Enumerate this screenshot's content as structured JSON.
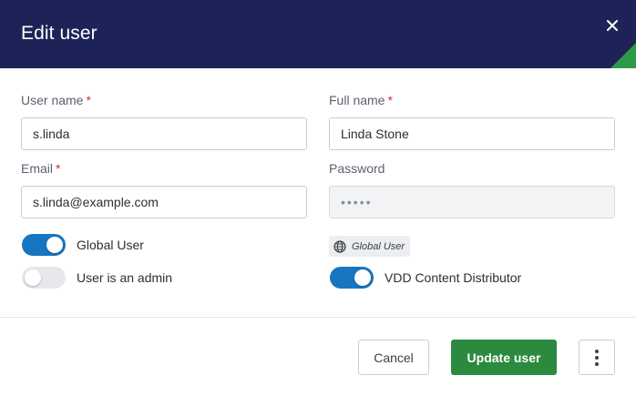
{
  "dialog": {
    "title": "Edit user",
    "close_icon": "close-icon"
  },
  "colors": {
    "header_bg": "#1d2357",
    "accent_green": "#2e9a48",
    "toggle_on": "#1676c2",
    "required": "#d0312d",
    "primary_button": "#2b8a3e"
  },
  "form": {
    "username": {
      "label": "User name",
      "required_mark": "*",
      "value": "s.linda"
    },
    "fullname": {
      "label": "Full name",
      "required_mark": "*",
      "value": "Linda Stone"
    },
    "email": {
      "label": "Email",
      "required_mark": "*",
      "value": "s.linda@example.com"
    },
    "password": {
      "label": "Password",
      "value": "•••••"
    }
  },
  "toggles": {
    "global_user": {
      "label": "Global User",
      "on": true
    },
    "is_admin": {
      "label": "User is an admin",
      "on": false
    },
    "vdd_distributor": {
      "label": "VDD Content Distributor",
      "on": true
    }
  },
  "scope_chip": {
    "icon": "globe-icon",
    "label": "Global User"
  },
  "footer": {
    "cancel_label": "Cancel",
    "update_label": "Update user",
    "more_icon": "more-vertical-icon"
  }
}
